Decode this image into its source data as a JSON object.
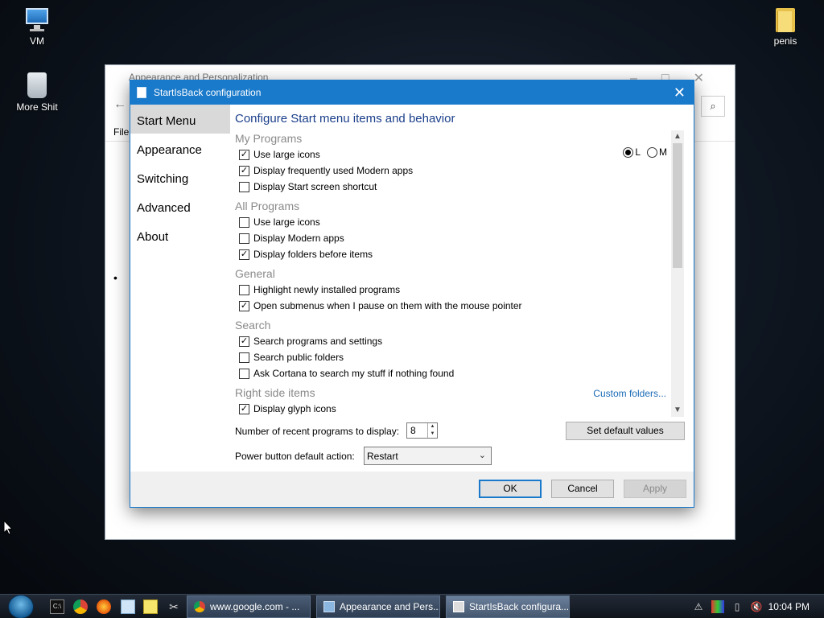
{
  "desktop": {
    "icons": [
      {
        "label": "VM",
        "icon": "computer-icon"
      },
      {
        "label": "More Shit",
        "icon": "recycle-bin-icon"
      },
      {
        "label": "penis",
        "icon": "folder-icon"
      }
    ]
  },
  "background_window": {
    "title": "Appearance and Personalization",
    "menu_file": "File"
  },
  "dialog": {
    "title": "StartIsBack configuration",
    "nav": [
      "Start Menu",
      "Appearance",
      "Switching",
      "Advanced",
      "About"
    ],
    "active_nav": "Start Menu",
    "heading": "Configure Start menu items and behavior",
    "sections": {
      "my_programs": {
        "title": "My Programs",
        "items": [
          {
            "label": "Use large icons",
            "checked": true
          },
          {
            "label": "Display frequently used Modern apps",
            "checked": true
          },
          {
            "label": "Display Start screen shortcut",
            "checked": false
          }
        ],
        "size_options": [
          "L",
          "M"
        ],
        "size_selected": "L"
      },
      "all_programs": {
        "title": "All Programs",
        "items": [
          {
            "label": "Use large icons",
            "checked": false
          },
          {
            "label": "Display Modern apps",
            "checked": false
          },
          {
            "label": "Display folders before items",
            "checked": true
          }
        ]
      },
      "general": {
        "title": "General",
        "items": [
          {
            "label": "Highlight newly installed programs",
            "checked": false
          },
          {
            "label": "Open submenus when I pause on them with the mouse pointer",
            "checked": true
          }
        ]
      },
      "search": {
        "title": "Search",
        "items": [
          {
            "label": "Search programs and settings",
            "checked": true
          },
          {
            "label": "Search public folders",
            "checked": false
          },
          {
            "label": "Ask Cortana to search my stuff if nothing found",
            "checked": false
          }
        ]
      },
      "right_side": {
        "title": "Right side items",
        "link": "Custom folders...",
        "items": [
          {
            "label": "Display glyph icons",
            "checked": true
          }
        ]
      }
    },
    "recent_label": "Number of recent programs to display:",
    "recent_value": "8",
    "power_label": "Power button default action:",
    "power_value": "Restart",
    "set_default_label": "Set default values",
    "ok_label": "OK",
    "cancel_label": "Cancel",
    "apply_label": "Apply"
  },
  "taskbar": {
    "buttons": [
      {
        "label": "www.google.com - ...",
        "active": false
      },
      {
        "label": "Appearance and Pers...",
        "active": false
      },
      {
        "label": "StartIsBack configura...",
        "active": true
      }
    ],
    "clock": "10:04 PM"
  },
  "colors": {
    "accent": "#1979ca",
    "link": "#1a6bb5",
    "heading": "#1a3e8a"
  }
}
